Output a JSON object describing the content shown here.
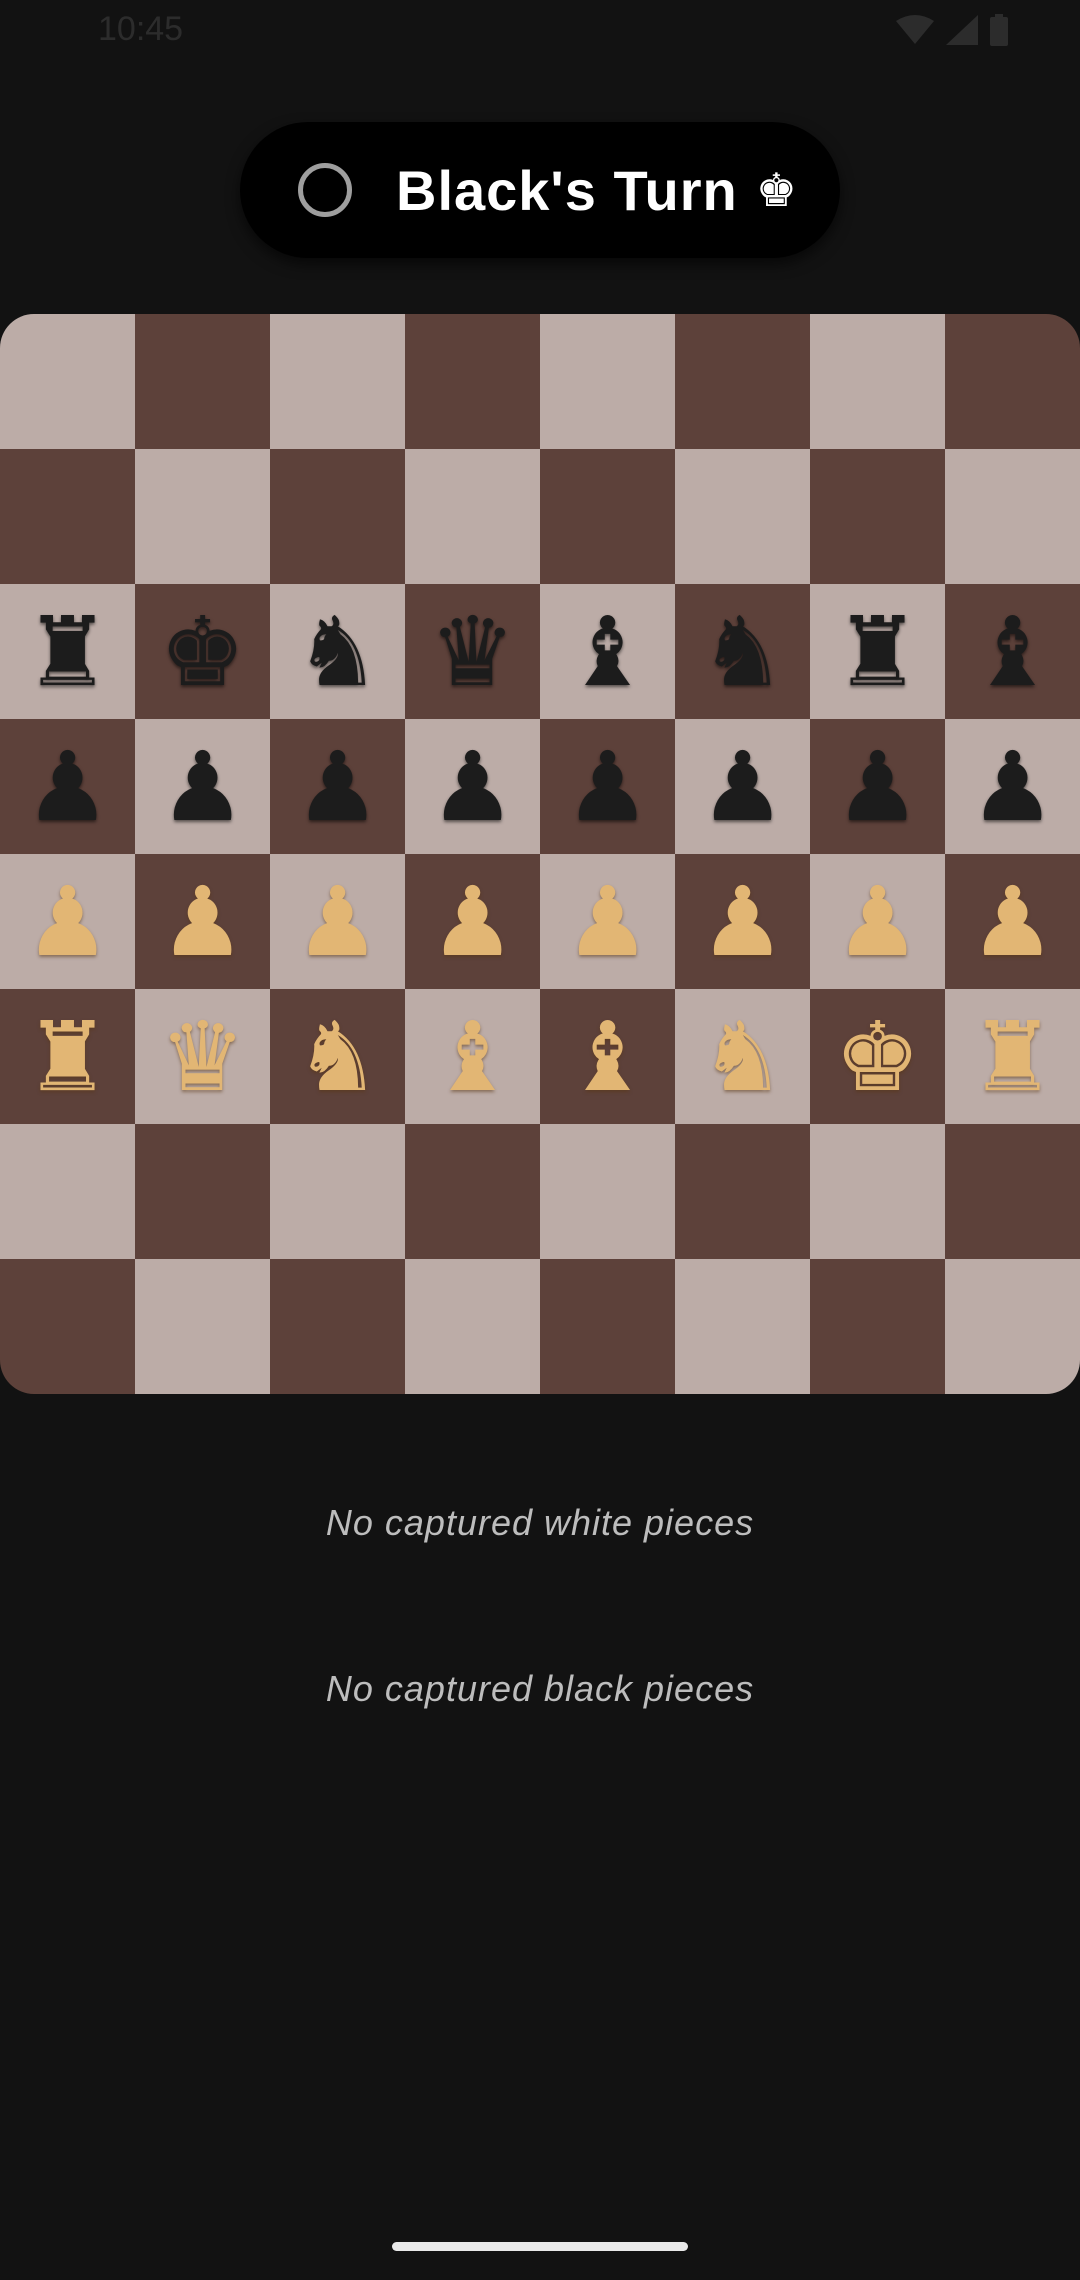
{
  "status_bar": {
    "time": "10:45",
    "icons": [
      "wifi-icon",
      "signal-icon",
      "battery-icon"
    ]
  },
  "turn_indicator": {
    "label": "Black's Turn",
    "king_symbol": "♚",
    "icon": "circle-outline-icon"
  },
  "colors": {
    "light_square": "#bcaca7",
    "dark_square": "#5d413a",
    "black_piece": "#1c1c1c",
    "white_piece": "#e2b674",
    "background": "#121212"
  },
  "board": {
    "rows": [
      [
        "",
        "",
        "",
        "",
        "",
        "",
        "",
        ""
      ],
      [
        "",
        "",
        "",
        "",
        "",
        "",
        "",
        ""
      ],
      [
        "r",
        "k",
        "n",
        "q",
        "b",
        "n",
        "r",
        "b"
      ],
      [
        "p",
        "p",
        "p",
        "p",
        "p",
        "p",
        "p",
        "p"
      ],
      [
        "P",
        "P",
        "P",
        "P",
        "P",
        "P",
        "P",
        "P"
      ],
      [
        "R",
        "Q",
        "N",
        "B",
        "B",
        "N",
        "K",
        "R"
      ],
      [
        "",
        "",
        "",
        "",
        "",
        "",
        "",
        ""
      ],
      [
        "",
        "",
        "",
        "",
        "",
        "",
        "",
        ""
      ]
    ]
  },
  "captured": {
    "white_text": "No captured white pieces",
    "black_text": "No captured black pieces"
  }
}
